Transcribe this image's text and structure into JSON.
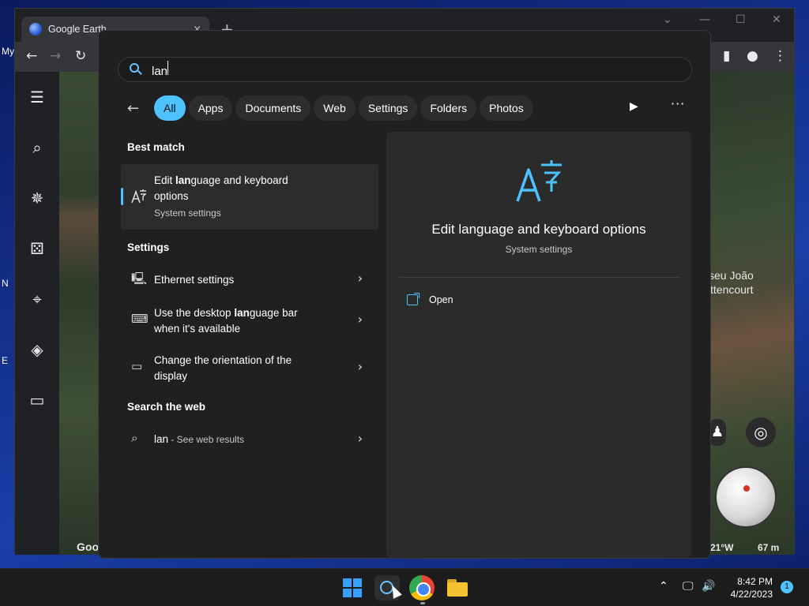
{
  "desktop": {
    "fragments": [
      "My",
      "N",
      "E"
    ]
  },
  "browser": {
    "tab_title": "Google Earth",
    "tab_close": "×",
    "new_tab": "+",
    "controls": {
      "minimize": "—",
      "maximize": "☐",
      "close": "✕",
      "dropdown": "⌄"
    },
    "toolbar": {
      "back": "←",
      "forward": "→",
      "reload": "↻",
      "sidepanel": "▮",
      "profile": "●",
      "menu": "⋮"
    }
  },
  "earth": {
    "place_label_line1": "seu João",
    "place_label_line2": "ttencourt",
    "coord_label": "21°W",
    "scale_label": "67 m",
    "google_logo": "Goo"
  },
  "search": {
    "query": "lan",
    "filters": [
      {
        "label": "All",
        "active": true
      },
      {
        "label": "Apps",
        "active": false
      },
      {
        "label": "Documents",
        "active": false
      },
      {
        "label": "Web",
        "active": false
      },
      {
        "label": "Settings",
        "active": false
      },
      {
        "label": "Folders",
        "active": false
      },
      {
        "label": "Photos",
        "active": false
      }
    ],
    "best_match_heading": "Best match",
    "best_match": {
      "title_pre": "Edit ",
      "title_bold": "lan",
      "title_post": "guage and keyboard",
      "title_line2": "options",
      "subtitle": "System settings",
      "icon": "language-icon"
    },
    "settings_heading": "Settings",
    "settings_results": [
      {
        "title_line1": "Ethernet settings",
        "title_line2": "",
        "icon": "ethernet-icon"
      },
      {
        "title_pre": "Use the desktop ",
        "title_bold": "lan",
        "title_post": "guage bar",
        "title_line2": "when it's available",
        "icon": "keyboard-icon"
      },
      {
        "title_line1": "Change the orientation of the",
        "title_line2": "display",
        "icon": "display-icon"
      }
    ],
    "web_heading": "Search the web",
    "web_result": {
      "query": "lan",
      "suffix": " - See web results",
      "icon": "search-icon"
    }
  },
  "preview": {
    "title": "Edit language and keyboard options",
    "subtitle": "System settings",
    "action_open": "Open"
  },
  "taskbar": {
    "time": "8:42 PM",
    "date": "4/22/2023",
    "notification_count": "1"
  },
  "colors": {
    "accent": "#4cc2ff",
    "panel_bg": "#202020",
    "taskbar_bg": "#1c1c1c"
  }
}
